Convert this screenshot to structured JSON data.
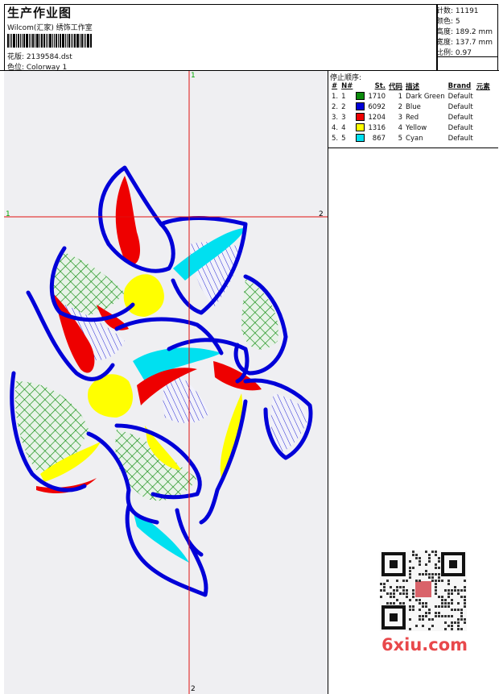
{
  "header": {
    "title": "生产作业图",
    "studio": "Wilcom(汇家) 绣饰工作室",
    "design_label": "花版: 2139584.dst",
    "colorway_label": "色位: Colorway 1"
  },
  "stats": {
    "stitches": "针数: 11191",
    "colors": "颜色: 5",
    "height": "高度: 189.2 mm",
    "width": "宽度: 137.7 mm",
    "scale": "比例: 0.97"
  },
  "legend": {
    "title": "停止顺序:",
    "headers": [
      "#",
      "N#",
      "St.",
      "代码",
      "描述",
      "Brand",
      "元素"
    ],
    "rows": [
      {
        "idx": "1.",
        "n": "1",
        "color": "#0a8a0a",
        "st": "1710",
        "code": "1",
        "desc": "Dark Green",
        "brand": "Default"
      },
      {
        "idx": "2.",
        "n": "2",
        "color": "#0000d8",
        "st": "6092",
        "code": "2",
        "desc": "Blue",
        "brand": "Default"
      },
      {
        "idx": "3.",
        "n": "3",
        "color": "#ee0000",
        "st": "1204",
        "code": "3",
        "desc": "Red",
        "brand": "Default"
      },
      {
        "idx": "4.",
        "n": "4",
        "color": "#ffff00",
        "st": "1316",
        "code": "4",
        "desc": "Yellow",
        "brand": "Default"
      },
      {
        "idx": "5.",
        "n": "5",
        "color": "#00e0f0",
        "st": "867",
        "code": "5",
        "desc": "Cyan",
        "brand": "Default"
      }
    ]
  },
  "guides": {
    "v_top": "1",
    "v_bottom": "2",
    "h_left": "1",
    "h_right": "2"
  },
  "watermark": {
    "site": "6xiu.com"
  }
}
